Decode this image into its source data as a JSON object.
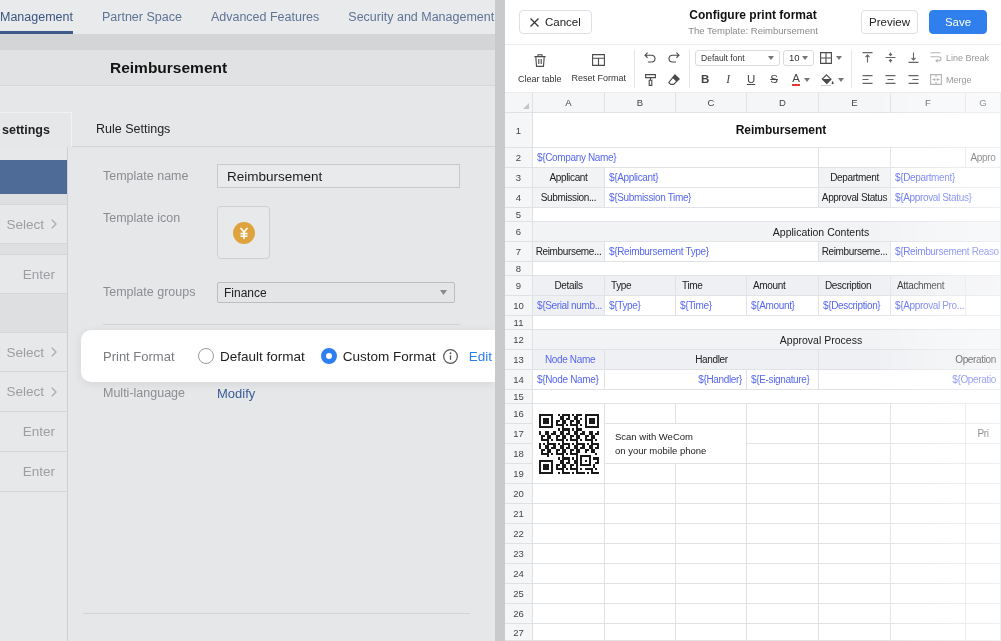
{
  "nav": {
    "tabs": [
      {
        "label": "Management",
        "selected": true
      },
      {
        "label": "Partner Space",
        "selected": false
      },
      {
        "label": "Advanced Features",
        "selected": false
      },
      {
        "label": "Security and Management",
        "selected": false
      }
    ]
  },
  "page_title": "Reimbursement",
  "form_tabs": [
    {
      "label": "settings",
      "selected": true
    },
    {
      "label": "Rule Settings",
      "selected": false
    }
  ],
  "left_column": {
    "groups": [
      [
        {
          "kind": "bar"
        }
      ],
      [
        {
          "kind": "select",
          "placeholder": "Select"
        }
      ],
      [
        {
          "kind": "input",
          "placeholder": "Enter"
        }
      ],
      [
        {
          "kind": "select",
          "placeholder": "Select"
        },
        {
          "kind": "select",
          "placeholder": "Select"
        },
        {
          "kind": "input",
          "placeholder": "Enter"
        },
        {
          "kind": "input",
          "placeholder": "Enter"
        }
      ]
    ]
  },
  "form": {
    "rows": [
      {
        "kind": "text",
        "label": "Template name",
        "value": "Reimbursement"
      },
      {
        "kind": "icon",
        "label": "Template icon"
      },
      {
        "kind": "select",
        "label": "Template groups",
        "value": "Finance"
      }
    ],
    "print_format": {
      "label": "Print Format",
      "options": [
        {
          "label": "Default format",
          "selected": false
        },
        {
          "label": "Custom Format",
          "selected": true
        }
      ],
      "link": "Edit"
    },
    "multi_language": {
      "label": "Multi-language",
      "link": "Modify"
    }
  },
  "dialog": {
    "cancel": "Cancel",
    "title": "Configure print format",
    "subtitle": "The Template: Reimbursement",
    "preview": "Preview",
    "save": "Save"
  },
  "toolbar": {
    "clear": "Clear table",
    "reset": "Reset Format",
    "font": "Default font",
    "size": "10",
    "styles": [
      {
        "kind": "bold",
        "glyph": "B"
      },
      {
        "kind": "italic",
        "glyph": "I"
      },
      {
        "kind": "underline",
        "glyph": "U"
      },
      {
        "kind": "strike",
        "glyph": "S"
      },
      {
        "kind": "color",
        "glyph": "A"
      }
    ],
    "line_break": {
      "label": "Line Break",
      "disabled": true
    },
    "merge": {
      "label": "Merge",
      "disabled": true
    }
  },
  "sheet": {
    "columns": [
      "A",
      "B",
      "C",
      "D",
      "E",
      "F",
      "G"
    ],
    "rows": [
      {
        "number": "1",
        "kind": "title",
        "cells": [
          {
            "kind": "title",
            "text": "Reimbursement",
            "colspan": 7
          }
        ]
      },
      {
        "number": "2",
        "kind": "plain",
        "cells": [
          {
            "kind": "field",
            "text": "${Company Name}",
            "colspan": 4
          },
          {
            "kind": "blank"
          },
          {
            "kind": "blank"
          },
          {
            "kind": "text",
            "text": "Appro"
          }
        ]
      },
      {
        "number": "3",
        "kind": "plain",
        "cells": [
          {
            "kind": "label",
            "text": "Applicant"
          },
          {
            "kind": "field",
            "text": "${Applicant}",
            "colspan": 3
          },
          {
            "kind": "label",
            "text": "Department"
          },
          {
            "kind": "field",
            "text": "${Department}",
            "colspan": 2
          }
        ]
      },
      {
        "number": "4",
        "kind": "plain",
        "cells": [
          {
            "kind": "label",
            "text": "Submission..."
          },
          {
            "kind": "field",
            "text": "${Submission Time}",
            "colspan": 3
          },
          {
            "kind": "label",
            "text": "Approval Status"
          },
          {
            "kind": "field",
            "text": "${Approval Status}",
            "colspan": 2
          }
        ]
      },
      {
        "number": "5",
        "kind": "spacer"
      },
      {
        "number": "6",
        "kind": "plain",
        "cells": [
          {
            "kind": "section",
            "text": "Application Contents",
            "colspan": 7
          }
        ]
      },
      {
        "number": "7",
        "kind": "plain",
        "cells": [
          {
            "kind": "label",
            "text": "Reimburseme..."
          },
          {
            "kind": "field",
            "text": "${Reimbursement Type}",
            "colspan": 3
          },
          {
            "kind": "label",
            "text": "Reimburseme..."
          },
          {
            "kind": "field",
            "text": "${Reimbursement Reaso",
            "colspan": 2
          }
        ]
      },
      {
        "number": "8",
        "kind": "spacer"
      },
      {
        "number": "9",
        "kind": "shaded",
        "cells": [
          {
            "kind": "label",
            "text": "Details"
          },
          {
            "kind": "header",
            "text": "Type"
          },
          {
            "kind": "header",
            "text": "Time"
          },
          {
            "kind": "header",
            "text": "Amount"
          },
          {
            "kind": "header",
            "text": "Description"
          },
          {
            "kind": "header",
            "text": "Attachment"
          }
        ]
      },
      {
        "number": "10",
        "kind": "plain",
        "cells": [
          {
            "kind": "field_shaded",
            "text": "${Serial numb..."
          },
          {
            "kind": "field",
            "text": "${Type}"
          },
          {
            "kind": "field",
            "text": "${Time}"
          },
          {
            "kind": "field",
            "text": "${Amount}"
          },
          {
            "kind": "field",
            "text": "${Description}"
          },
          {
            "kind": "field",
            "text": "${Approval Pro..."
          }
        ]
      },
      {
        "number": "11",
        "kind": "spacer"
      },
      {
        "number": "12",
        "kind": "plain",
        "cells": [
          {
            "kind": "section",
            "text": "Approval Process",
            "colspan": 7
          }
        ]
      },
      {
        "number": "13",
        "kind": "shaded",
        "cells": [
          {
            "kind": "field_label",
            "text": "Node Name"
          },
          {
            "kind": "label",
            "text": "Handler",
            "colspan": 3
          },
          {
            "kind": "label_end",
            "text": "Operation",
            "colspan": 3
          }
        ]
      },
      {
        "number": "14",
        "kind": "plain",
        "cells": [
          {
            "kind": "field",
            "text": "${Node Name}"
          },
          {
            "kind": "field_end",
            "text": "${Handler}",
            "colspan": 2
          },
          {
            "kind": "field",
            "text": "${E-signature}"
          },
          {
            "kind": "field_end",
            "text": "${Operatio",
            "colspan": 3
          }
        ]
      },
      {
        "number": "15",
        "kind": "spacer"
      },
      {
        "number": "16",
        "kind": "plain",
        "cells": [
          {
            "kind": "qr",
            "rowspan": 4
          }
        ]
      },
      {
        "number": "17",
        "kind": "plain",
        "cells": [
          {
            "kind": "note",
            "text": "Scan with WeCom\non your mobile phone",
            "colspan": 2,
            "rowspan": 2
          },
          {
            "kind": "blank"
          },
          {
            "kind": "blank"
          },
          {
            "kind": "blank"
          },
          {
            "kind": "text",
            "text": "Pri"
          }
        ]
      },
      {
        "number": "18",
        "kind": "plain"
      },
      {
        "number": "19",
        "kind": "plain"
      },
      {
        "number": "20",
        "kind": "plain"
      },
      {
        "number": "21",
        "kind": "plain"
      },
      {
        "number": "22",
        "kind": "plain"
      },
      {
        "number": "23",
        "kind": "plain"
      },
      {
        "number": "24",
        "kind": "plain"
      },
      {
        "number": "25",
        "kind": "plain"
      },
      {
        "number": "26",
        "kind": "plain"
      },
      {
        "number": "27",
        "kind": "plain"
      }
    ]
  }
}
